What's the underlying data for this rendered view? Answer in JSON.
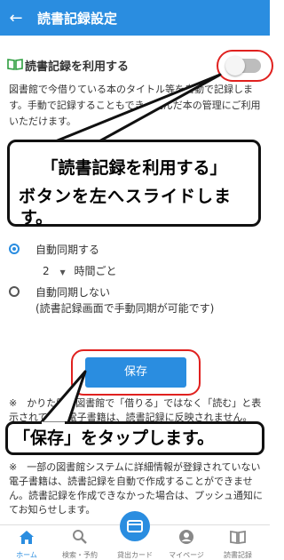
{
  "header": {
    "title": "読書記録設定",
    "back_icon": "arrow-left-icon"
  },
  "setting": {
    "label": "読書記録を利用する",
    "enabled": false,
    "description_visible": "図書館で今借りている本のタイトル等を自動で記録します。手動で記録することもでき、読んだ本の管理にご利用いただけます。"
  },
  "callout_toggle": {
    "line1": "「読書記録を利用する」",
    "line2": "ボタンを左へスライドしま",
    "line3": "す。"
  },
  "sync_options": {
    "auto": "自動同期する",
    "interval_value": "2",
    "interval_unit": "時間ごと",
    "manual": "自動同期しない",
    "manual_note": "(読書記録画面で手動同期が可能です)"
  },
  "save_button": "保存",
  "note1": "※　かりた電子図書館で「借りる」ではなく「読む」と表示されている電子書籍は、読書記録に反映されません。",
  "callout_save": "「保存」をタップします。",
  "note2": "※　一部の図書館システムに詳細情報が登録されていない電子書籍は、読書記録を自動で作成することができません。読書記録を作成できなかった場合は、プッシュ通知にてお知らせします。",
  "nav": {
    "home": "ホーム",
    "search": "検索・予約",
    "card": "貸出カード",
    "mypage": "マイページ",
    "records": "読書記録"
  },
  "colors": {
    "accent": "#2a8de0",
    "highlight": "#e0211f"
  }
}
